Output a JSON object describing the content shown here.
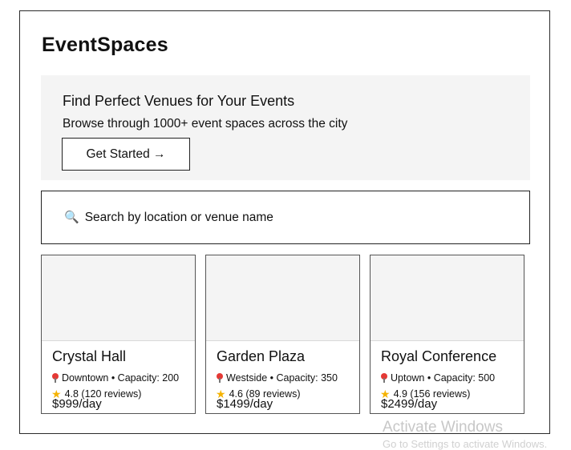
{
  "header": {
    "brand": "EventSpaces"
  },
  "hero": {
    "title": "Find Perfect Venues for Your Events",
    "subtitle": "Browse through 1000+ event spaces across the city",
    "cta_label": "Get Started →"
  },
  "search": {
    "icon": "magnifier-icon",
    "placeholder": "Search by location or venue name"
  },
  "venues": [
    {
      "name": "Crystal Hall",
      "location": "Downtown • Capacity: 200",
      "rating": "4.8 (120 reviews)",
      "price": "$999/day"
    },
    {
      "name": "Garden Plaza",
      "location": "Westside • Capacity: 350",
      "rating": "4.6 (89 reviews)",
      "price": "$1499/day"
    },
    {
      "name": "Royal Conference",
      "location": "Uptown • Capacity: 500",
      "rating": "4.9 (156 reviews)",
      "price": "$2499/day"
    }
  ],
  "os_overlay": {
    "watermark": "Activate Windows",
    "watermark_sub": "Go to Settings to activate Windows."
  },
  "colors": {
    "hero_bg": "#f4f4f4",
    "border": "#222222",
    "pin": "#e53935",
    "star": "#f5b301"
  }
}
